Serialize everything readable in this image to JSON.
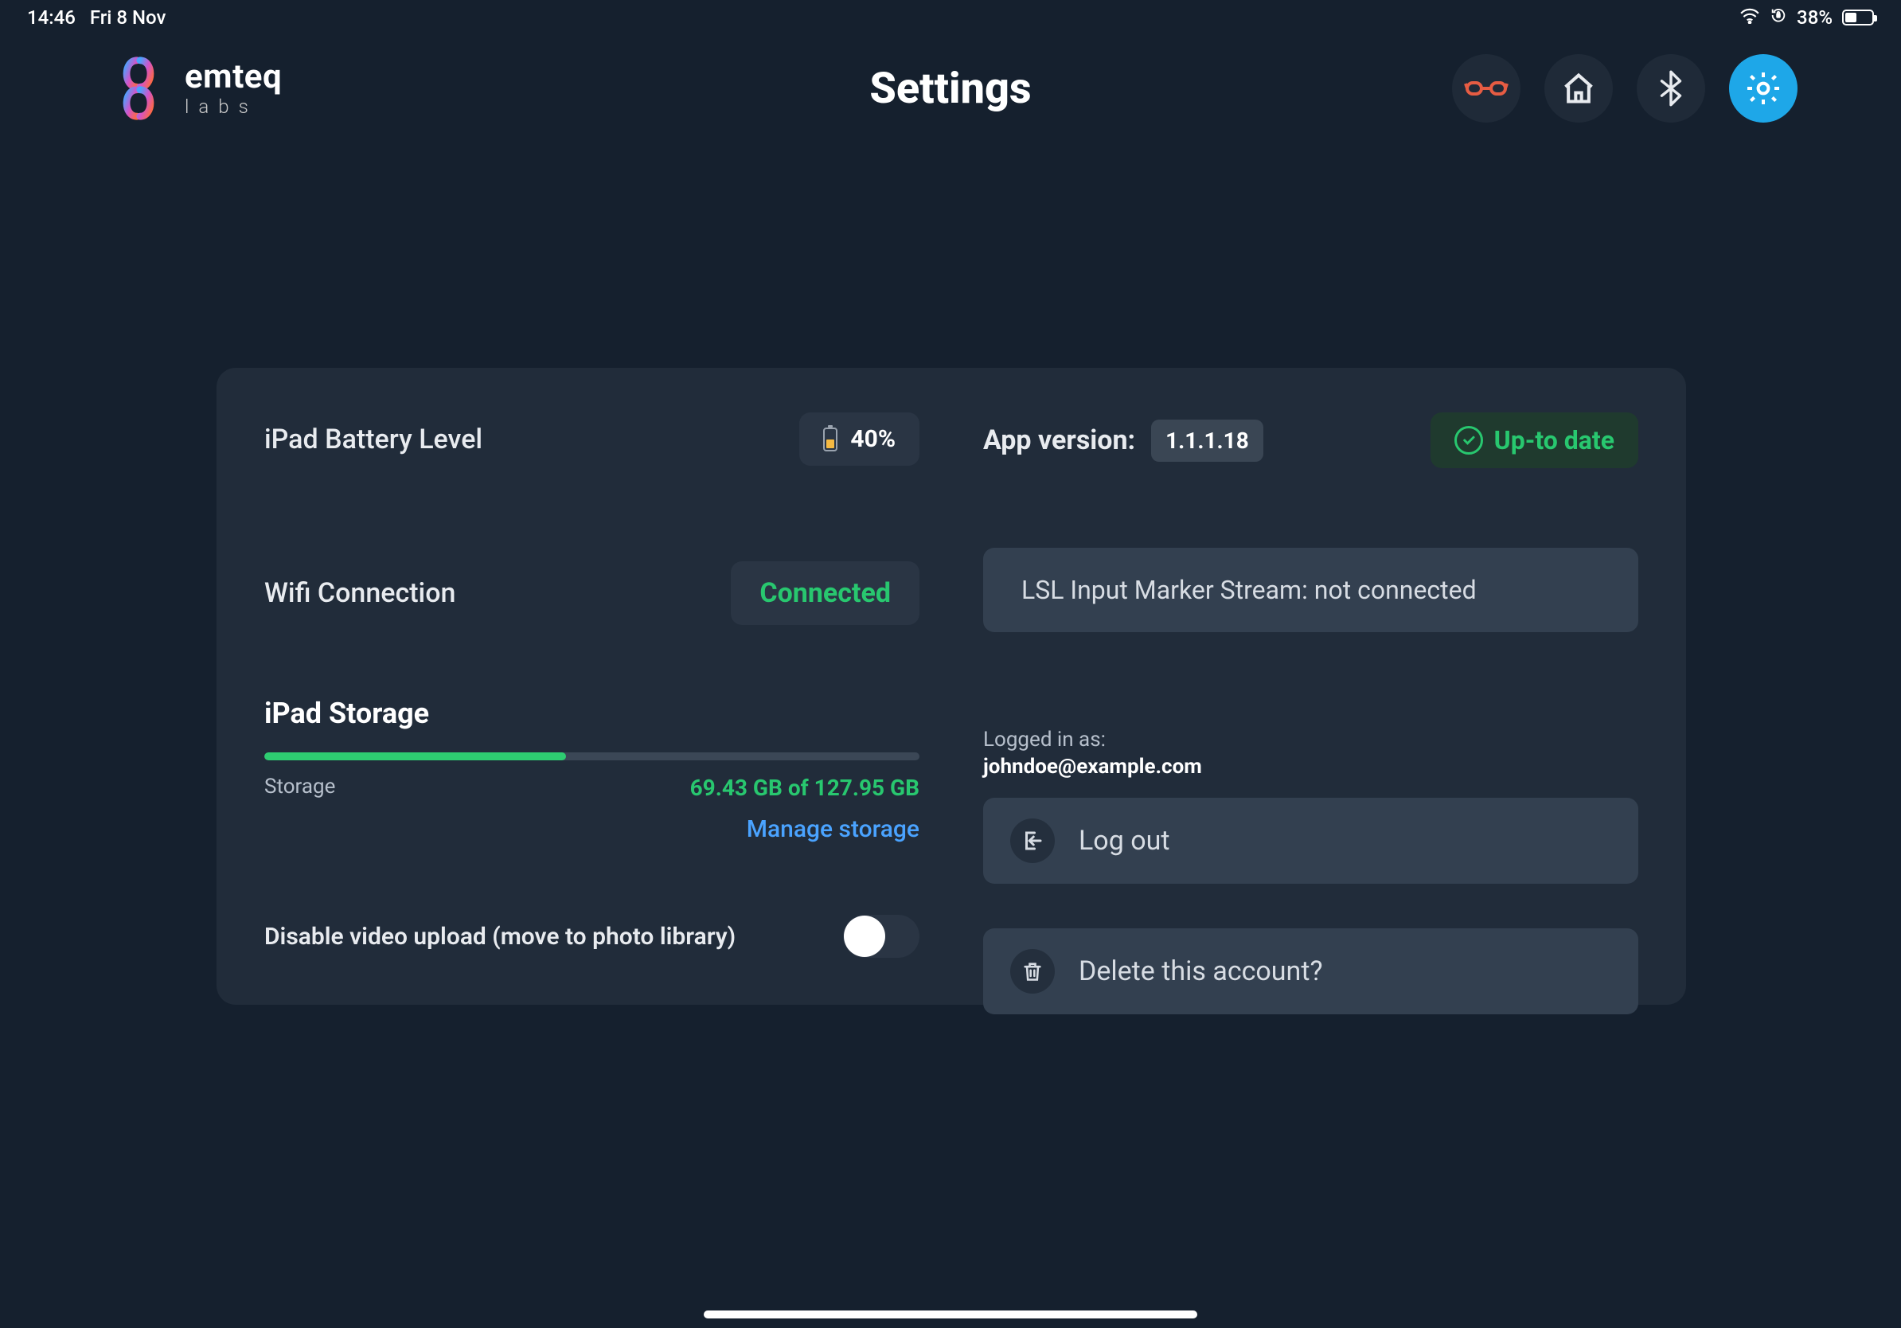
{
  "status": {
    "time": "14:46",
    "date": "Fri 8 Nov",
    "battery_percent": "38%"
  },
  "brand": {
    "name": "emteq",
    "tagline": "labs"
  },
  "page_title": "Settings",
  "left": {
    "battery": {
      "label": "iPad Battery Level",
      "value": "40%"
    },
    "wifi": {
      "label": "Wifi Connection",
      "status": "Connected"
    },
    "storage": {
      "title": "iPad Storage",
      "label": "Storage",
      "value": "69.43 GB of 127.95 GB",
      "used_pct": 54,
      "manage_link": "Manage storage"
    },
    "toggle_label": "Disable video upload (move to photo library)",
    "toggle_on": false
  },
  "right": {
    "app_version_label": "App version:",
    "app_version": "1.1.1.18",
    "update_status": "Up-to date",
    "lsl_text": "LSL Input Marker Stream: not connected",
    "login_label": "Logged in as:",
    "login_email": "johndoe@example.com",
    "logout_label": "Log out",
    "delete_label": "Delete this account?"
  }
}
